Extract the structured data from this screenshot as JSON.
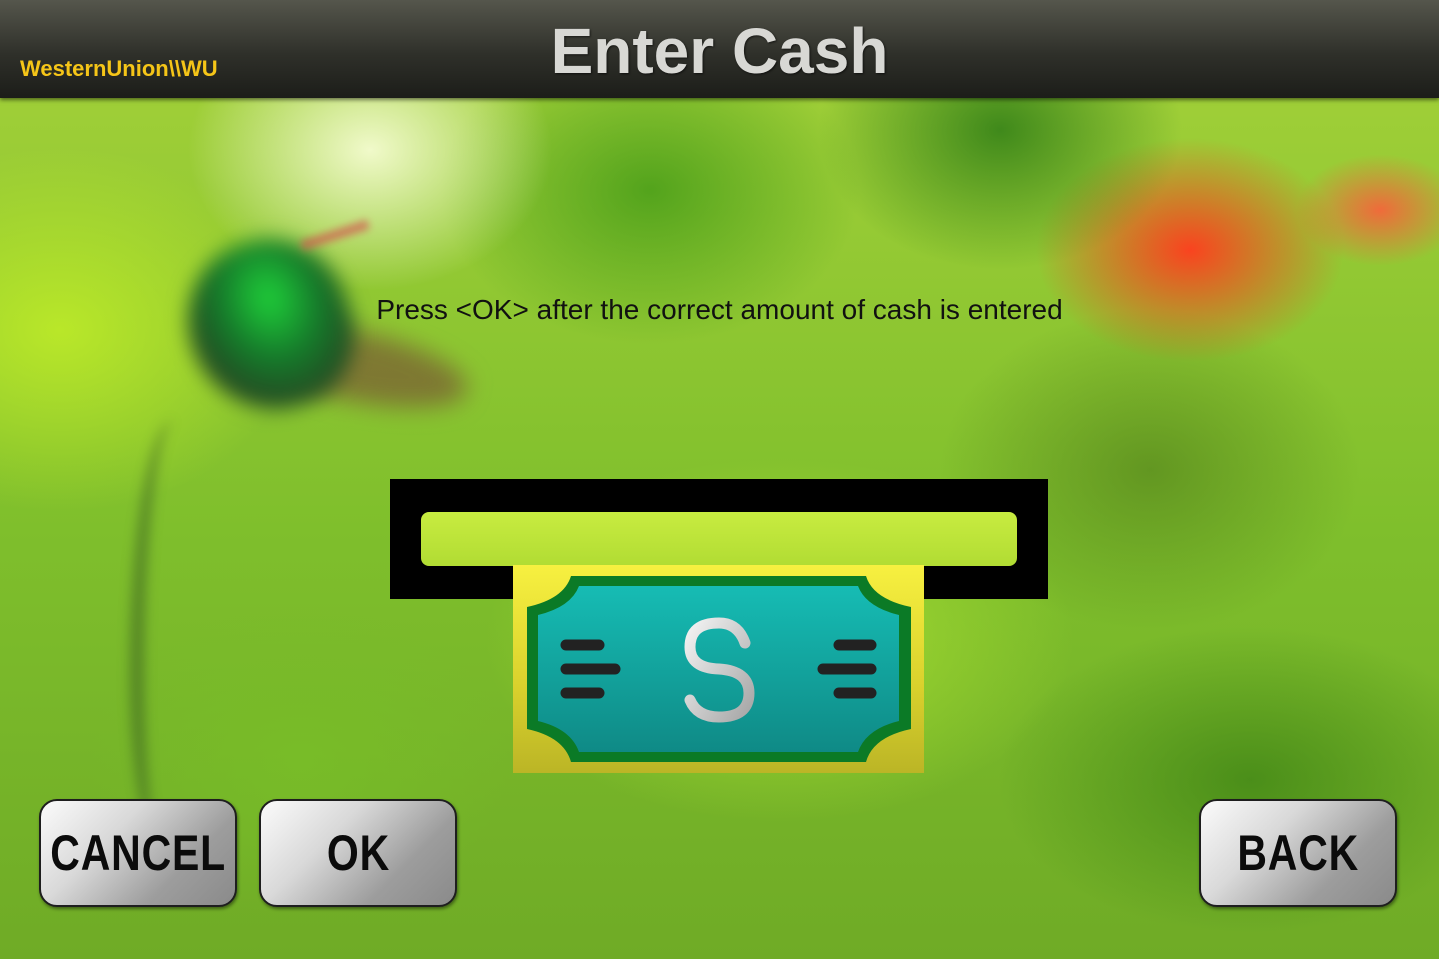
{
  "header": {
    "brand": "WesternUnion\\\\WU",
    "title": "Enter Cash"
  },
  "main": {
    "instruction": "Press <OK> after the correct amount of cash is entered",
    "illustration": {
      "slot_icon": "cash-slot-icon",
      "note_icon": "dollar-bill-icon",
      "currency_symbol": "$"
    }
  },
  "buttons": {
    "cancel_label": "CANCEL",
    "ok_label": "OK",
    "back_label": "BACK"
  },
  "colors": {
    "header_bg": "#2f302a",
    "brand": "#f5c518",
    "title": "#d8d8d4",
    "note_teal": "#17a8a0",
    "note_border": "#0b7a26"
  }
}
